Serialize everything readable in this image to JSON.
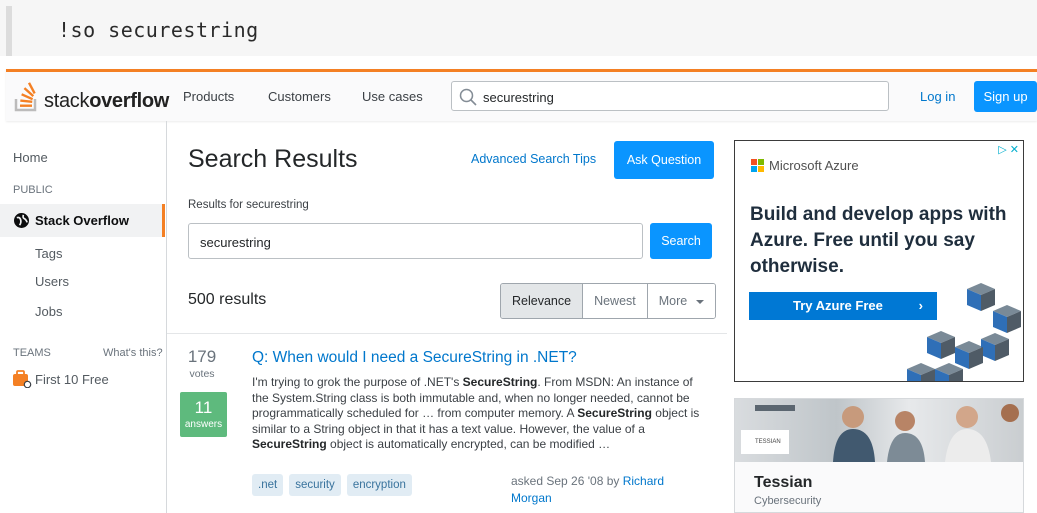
{
  "command": {
    "text": "!so securestring"
  },
  "header": {
    "logo_text_light": "stack",
    "logo_text_bold": "overflow",
    "nav": [
      "Products",
      "Customers",
      "Use cases"
    ],
    "search_value": "securestring",
    "login": "Log in",
    "signup": "Sign up",
    "colors": {
      "accent": "#f48024",
      "primary": "#0a95ff",
      "link": "#0077cc"
    }
  },
  "sidebar": {
    "home": "Home",
    "public_label": "PUBLIC",
    "stack_overflow": "Stack Overflow",
    "tags": "Tags",
    "users": "Users",
    "jobs": "Jobs",
    "teams_label": "TEAMS",
    "whats_this": "What's this?",
    "first_free": "First 10 Free"
  },
  "main": {
    "title": "Search Results",
    "advanced_tips": "Advanced Search Tips",
    "ask_button": "Ask Question",
    "results_for": "Results for securestring",
    "query": "securestring",
    "search_button": "Search",
    "result_count": "500 results",
    "sort_tabs": [
      "Relevance",
      "Newest",
      "More"
    ],
    "result": {
      "votes": "179",
      "votes_label": "votes",
      "answers": "11",
      "answers_label": "answers",
      "title": "Q: When would I need a SecureString in .NET?",
      "excerpt_parts": [
        "I'm trying to grok the purpose of .NET's ",
        "SecureString",
        ". From MSDN: An instance of the System.String class is both immutable and, when no longer needed, cannot be programmatically scheduled for … from computer memory. A ",
        "SecureString",
        " object is similar to a String object in that it has a text value. However, the value of a ",
        "SecureString",
        " object is automatically encrypted, can be modified …"
      ],
      "tags": [
        ".net",
        "security",
        "encryption"
      ],
      "asked_prefix": "asked Sep 26 '08 by ",
      "author": "Richard Morgan"
    }
  },
  "ads": {
    "azure": {
      "brand": "Microsoft Azure",
      "headline": "Build and develop apps with Azure. Free until you say otherwise.",
      "cta": "Try Azure Free",
      "adchoices": "▷ ✕"
    },
    "tessian": {
      "photo_logo": "TESSIAN",
      "name": "Tessian",
      "category": "Cybersecurity"
    }
  }
}
